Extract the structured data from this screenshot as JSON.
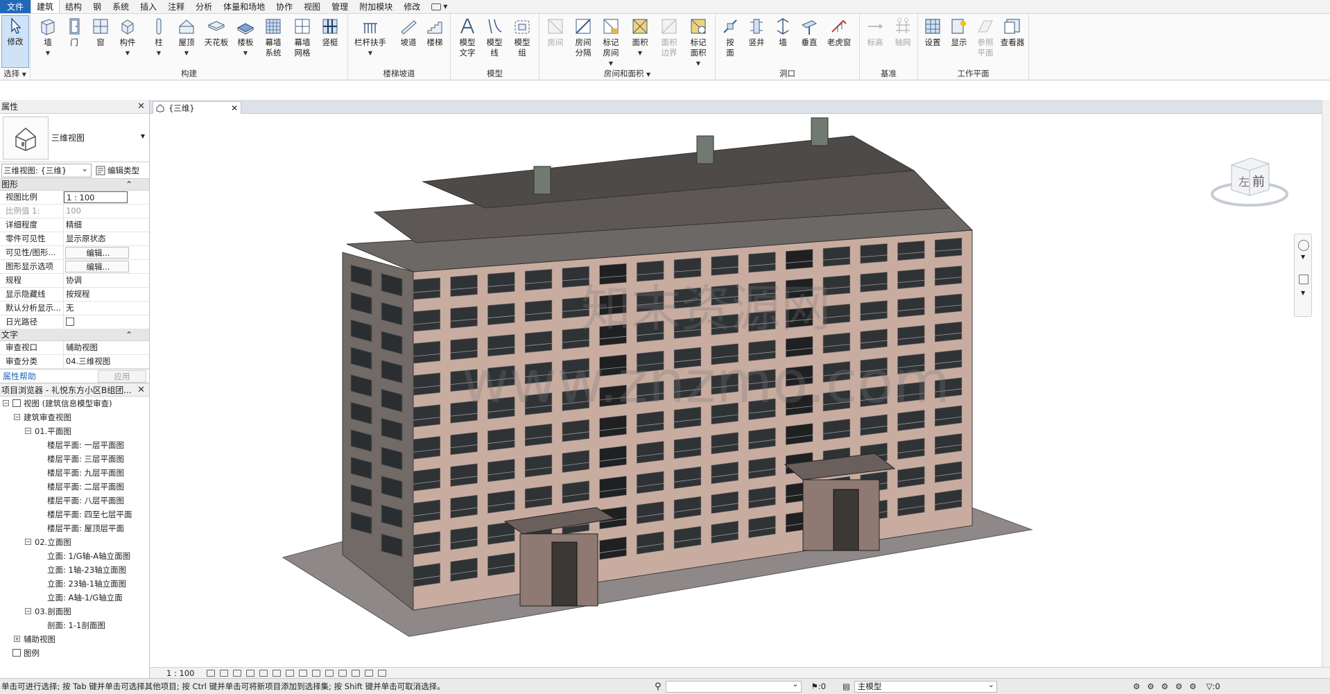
{
  "menu": {
    "file": "文件",
    "tabs": [
      "建筑",
      "结构",
      "钢",
      "系统",
      "插入",
      "注释",
      "分析",
      "体量和场地",
      "协作",
      "视图",
      "管理",
      "附加模块",
      "修改"
    ],
    "active_index": 0
  },
  "ribbon": {
    "select": {
      "modify": "修改",
      "group": "选择"
    },
    "build": {
      "buttons": [
        "墙",
        "门",
        "窗",
        "构件",
        "柱",
        "屋顶",
        "天花板",
        "楼板",
        "幕墙\n系统",
        "幕墙\n网格",
        "竖梃"
      ],
      "group": "构建"
    },
    "stairs": {
      "buttons": [
        "栏杆扶手",
        "坡道",
        "楼梯"
      ],
      "group": "楼梯坡道"
    },
    "model": {
      "buttons": [
        "模型\n文字",
        "模型\n线",
        "模型\n组"
      ],
      "group": "模型"
    },
    "room": {
      "buttons": [
        "房间",
        "房间\n分隔",
        "标记\n房间",
        "面积",
        "面积\n边界",
        "标记\n面积"
      ],
      "group": "房间和面积"
    },
    "opening": {
      "buttons": [
        "按\n面",
        "竖井",
        "墙",
        "垂直",
        "老虎窗"
      ],
      "group": "洞口"
    },
    "datum": {
      "buttons": [
        "标高",
        "轴网"
      ],
      "group": "基准"
    },
    "workplane": {
      "buttons": [
        "设置",
        "显示",
        "参照\n平面",
        "查看器"
      ],
      "group": "工作平面"
    }
  },
  "properties": {
    "title": "属性",
    "type_name": "三维视图",
    "view_selector": "三维视图: {三维}",
    "edit_type": "编辑类型",
    "section_graphics": "图形",
    "rows_graphics": [
      {
        "k": "视图比例",
        "v": "1 : 100",
        "style": "box"
      },
      {
        "k": "比例值 1:",
        "v": "100",
        "style": "dim"
      },
      {
        "k": "详细程度",
        "v": "精细",
        "style": ""
      },
      {
        "k": "零件可见性",
        "v": "显示原状态",
        "style": ""
      },
      {
        "k": "可见性/图形...",
        "v": "编辑...",
        "style": "btn"
      },
      {
        "k": "图形显示选项",
        "v": "编辑...",
        "style": "btn"
      },
      {
        "k": "规程",
        "v": "协调",
        "style": ""
      },
      {
        "k": "显示隐藏线",
        "v": "按规程",
        "style": ""
      },
      {
        "k": "默认分析显示...",
        "v": "无",
        "style": ""
      },
      {
        "k": "日光路径",
        "v": "",
        "style": "chk"
      }
    ],
    "section_text": "文字",
    "rows_text": [
      {
        "k": "审查视口",
        "v": "辅助视图",
        "style": ""
      },
      {
        "k": "审查分类",
        "v": "04.三维视图",
        "style": ""
      }
    ],
    "help": "属性帮助",
    "apply": "应用"
  },
  "browser": {
    "title": "项目浏览器 - 礼悦东方小区B组团...",
    "nodes": [
      {
        "label": "视图 (建筑信息模型审查)",
        "level": 0,
        "exp": "−",
        "icon": true,
        "bold": true
      },
      {
        "label": "建筑审查视图",
        "level": 1,
        "exp": "−"
      },
      {
        "label": "01.平面图",
        "level": 2,
        "exp": "−"
      },
      {
        "label": "楼层平面: 一层平面图",
        "level": 3
      },
      {
        "label": "楼层平面: 三层平面图",
        "level": 3
      },
      {
        "label": "楼层平面: 九层平面图",
        "level": 3
      },
      {
        "label": "楼层平面: 二层平面图",
        "level": 3
      },
      {
        "label": "楼层平面: 八层平面图",
        "level": 3
      },
      {
        "label": "楼层平面: 四至七层平面",
        "level": 3
      },
      {
        "label": "楼层平面: 屋顶层平面",
        "level": 3
      },
      {
        "label": "02.立面图",
        "level": 2,
        "exp": "−"
      },
      {
        "label": "立面: 1/G轴-A轴立面图",
        "level": 3
      },
      {
        "label": "立面: 1轴-23轴立面图",
        "level": 3
      },
      {
        "label": "立面: 23轴-1轴立面图",
        "level": 3
      },
      {
        "label": "立面: A轴-1/G轴立面",
        "level": 3
      },
      {
        "label": "03.剖面图",
        "level": 2,
        "exp": "−"
      },
      {
        "label": "剖面: 1-1剖面图",
        "level": 3
      },
      {
        "label": "辅助视图",
        "level": 1,
        "exp": "+"
      },
      {
        "label": "图例",
        "level": 0,
        "icon": true
      }
    ]
  },
  "view": {
    "tab_label": "{三维}",
    "scale": "1 : 100",
    "watermark_cn": "知末资源网",
    "watermark_url": "www.znzmo.com",
    "viewcube_left": "左",
    "viewcube_front": "前"
  },
  "status": {
    "message": "单击可进行选择; 按 Tab 键并单击可选择其他项目; 按 Ctrl 键并单击可将新项目添加到选择集; 按 Shift 键并单击可取消选择。",
    "zero": ":0",
    "model": "主模型",
    "filter": ":0"
  },
  "colors": {
    "accent": "#2368b8",
    "facade": "#c9aca0",
    "dark": "#5a5654",
    "glass": "#2f3336",
    "ground": "#8f8888"
  }
}
